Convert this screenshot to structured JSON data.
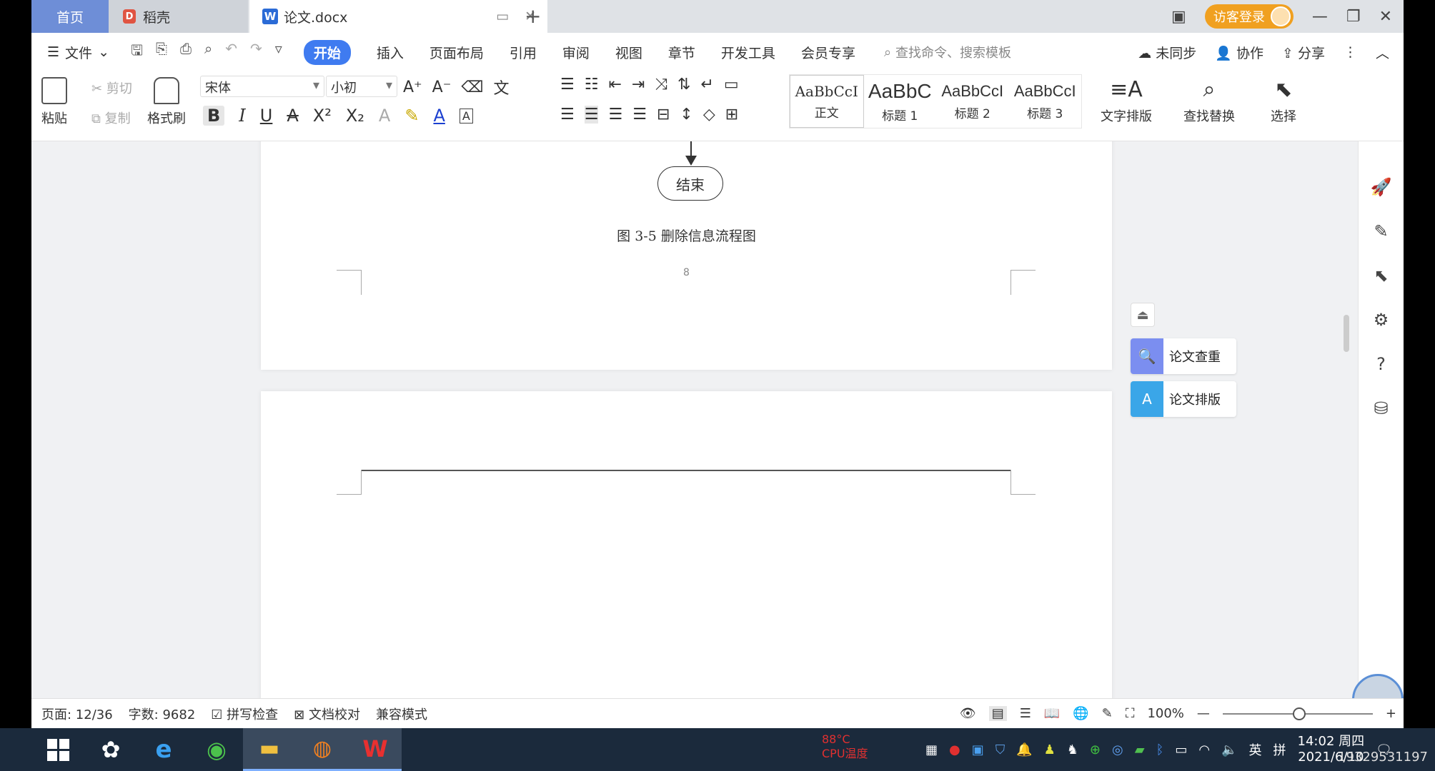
{
  "tabs": {
    "home": "首页",
    "daoke": "稻壳",
    "doc": "论文.docx",
    "new_tab": "+"
  },
  "titlebar": {
    "login": "访客登录"
  },
  "menu": {
    "file": "文件",
    "items": [
      "开始",
      "插入",
      "页面布局",
      "引用",
      "审阅",
      "视图",
      "章节",
      "开发工具",
      "会员专享"
    ],
    "search_placeholder": "查找命令、搜索模板",
    "sync": "未同步",
    "collab": "协作",
    "share": "分享"
  },
  "ribbon": {
    "paste": "粘贴",
    "cut": "剪切",
    "copy": "复制",
    "format_painter": "格式刷",
    "font_name": "宋体",
    "font_size": "小初",
    "styles": [
      {
        "sample": "AaBbCcI",
        "label": "正文"
      },
      {
        "sample": "AaBbC",
        "label": "标题 1"
      },
      {
        "sample": "AaBbCcI",
        "label": "标题 2"
      },
      {
        "sample": "AaBbCcI",
        "label": "标题 3"
      }
    ],
    "text_layout": "文字排版",
    "find_replace": "查找替换",
    "select": "选择"
  },
  "document": {
    "flow_end": "结束",
    "caption": "图 3-5  删除信息流程图",
    "page_number": "8"
  },
  "side_panel": {
    "check": "论文查重",
    "layout": "论文排版"
  },
  "status": {
    "page": "页面: 12/36",
    "word_count": "字数: 9682",
    "spell_check": "拼写检查",
    "doc_compare": "文档校对",
    "compat_mode": "兼容模式",
    "zoom": "100%"
  },
  "taskbar": {
    "cpu_temp": "88°C",
    "cpu_label": "CPU温度",
    "ime": "英",
    "time": "14:02 周四",
    "date": "2021/6/10",
    "watermark": "19329531197"
  }
}
